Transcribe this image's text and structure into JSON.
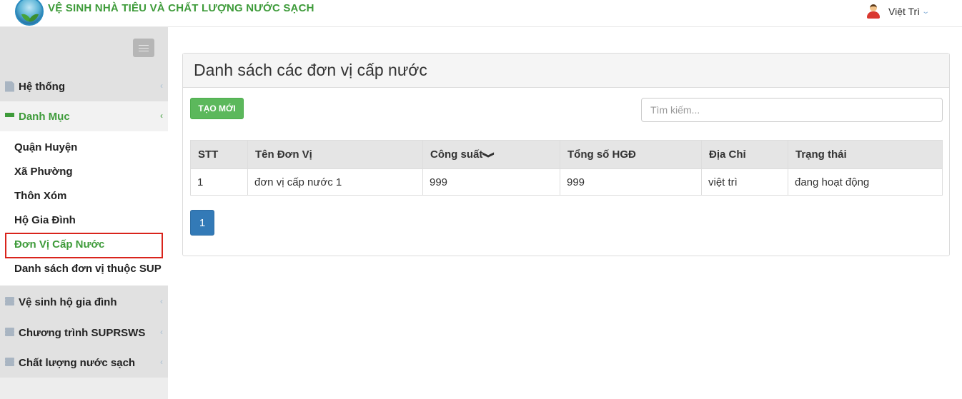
{
  "app": {
    "title": "VỆ SINH NHÀ TIÊU VÀ CHẤT LƯỢNG NƯỚC SẠCH"
  },
  "user": {
    "name": "Việt Trì",
    "caret": "⌄"
  },
  "sidebar": {
    "items": [
      {
        "label": "Hệ thống",
        "icon": "file-icon"
      },
      {
        "label": "Danh Mục",
        "icon": "list-icon",
        "active": true
      },
      {
        "label": "Vệ sinh hộ gia đình",
        "icon": "server-icon"
      },
      {
        "label": "Chương trình SUPRSWS",
        "icon": "server-icon"
      },
      {
        "label": "Chất lượng nước sạch",
        "icon": "server-icon"
      }
    ],
    "submenu": [
      "Quận Huyện",
      "Xã Phường",
      "Thôn Xóm",
      "Hộ Gia Đình",
      "Đơn Vị Cấp Nước",
      "Danh sách đơn vị thuộc SUP"
    ],
    "current_sub": "Đơn Vị Cấp Nước",
    "chevron": "‹"
  },
  "main": {
    "title": "Danh sách các đơn vị cấp nước",
    "create_label": "TẠO MỚI",
    "search_placeholder": "Tìm kiếm...",
    "table": {
      "headers": [
        "STT",
        "Tên Đơn Vị",
        "Công suất",
        "Tổng số HGĐ",
        "Địa Chỉ",
        "Trạng thái"
      ],
      "sort_icon": "❯",
      "rows": [
        [
          "1",
          "đơn vị cấp nước 1",
          "999",
          "999",
          "việt trì",
          "đang hoạt động"
        ]
      ]
    },
    "pagination": {
      "current": "1"
    }
  },
  "colors": {
    "brand_green": "#3e9b3a",
    "button_green": "#5cb85c",
    "page_blue": "#337ab7",
    "highlight_red": "#d9241c"
  }
}
